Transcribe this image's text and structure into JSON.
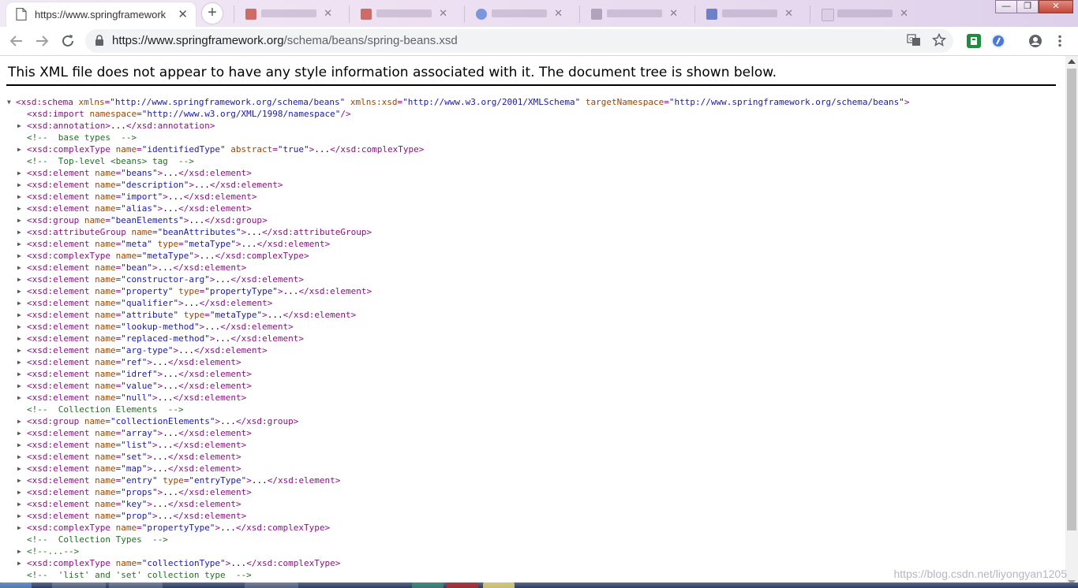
{
  "browser": {
    "active_tab": {
      "title": "https://www.springframework.org/schema/beans/spring-beans.xsd",
      "title_display": "https://www.springframework"
    },
    "new_tab_symbol": "+",
    "close_symbol": "✕",
    "window_controls": {
      "minimize": "—",
      "maximize": "❐",
      "close": "✕"
    },
    "url": {
      "host": "https://www.springframework.org",
      "path": "/schema/beans/spring-beans.xsd"
    },
    "icons": [
      "back-icon",
      "forward-icon",
      "reload-icon",
      "lock-icon",
      "translate-icon",
      "bookmark-star-icon",
      "extension-icon",
      "profile-icon",
      "menu-icon"
    ],
    "colors": {
      "tag": "#881280",
      "attribute": "#994500",
      "value": "#1a1aa6",
      "comment": "#236e25"
    }
  },
  "page": {
    "header_message": "This XML file does not appear to have any style information associated with it. The document tree is shown below."
  },
  "tree": [
    {
      "text": "<xsd:schema xmlns=\"http://www.springframework.org/schema/beans\" xmlns:xsd=\"http://www.w3.org/2001/XMLSchema\" targetNamespace=\"http://www.springframework.org/schema/beans\">",
      "kind": "root",
      "expand": "▼"
    },
    {
      "text": "<xsd:import namespace=\"http://www.w3.org/XML/1998/namespace\"/>",
      "kind": "leaf"
    },
    {
      "text": "<xsd:annotation>...</xsd:annotation>",
      "kind": "collapsed"
    },
    {
      "text": "<!--  base types  -->",
      "kind": "comment"
    },
    {
      "text": "<xsd:complexType name=\"identifiedType\" abstract=\"true\">...</xsd:complexType>",
      "kind": "collapsed"
    },
    {
      "text": "<!--  Top-level <beans> tag  -->",
      "kind": "comment"
    },
    {
      "text": "<xsd:element name=\"beans\">...</xsd:element>",
      "kind": "collapsed"
    },
    {
      "text": "<xsd:element name=\"description\">...</xsd:element>",
      "kind": "collapsed"
    },
    {
      "text": "<xsd:element name=\"import\">...</xsd:element>",
      "kind": "collapsed"
    },
    {
      "text": "<xsd:element name=\"alias\">...</xsd:element>",
      "kind": "collapsed"
    },
    {
      "text": "<xsd:group name=\"beanElements\">...</xsd:group>",
      "kind": "collapsed"
    },
    {
      "text": "<xsd:attributeGroup name=\"beanAttributes\">...</xsd:attributeGroup>",
      "kind": "collapsed"
    },
    {
      "text": "<xsd:element name=\"meta\" type=\"metaType\">...</xsd:element>",
      "kind": "collapsed"
    },
    {
      "text": "<xsd:complexType name=\"metaType\">...</xsd:complexType>",
      "kind": "collapsed"
    },
    {
      "text": "<xsd:element name=\"bean\">...</xsd:element>",
      "kind": "collapsed"
    },
    {
      "text": "<xsd:element name=\"constructor-arg\">...</xsd:element>",
      "kind": "collapsed"
    },
    {
      "text": "<xsd:element name=\"property\" type=\"propertyType\">...</xsd:element>",
      "kind": "collapsed"
    },
    {
      "text": "<xsd:element name=\"qualifier\">...</xsd:element>",
      "kind": "collapsed"
    },
    {
      "text": "<xsd:element name=\"attribute\" type=\"metaType\">...</xsd:element>",
      "kind": "collapsed"
    },
    {
      "text": "<xsd:element name=\"lookup-method\">...</xsd:element>",
      "kind": "collapsed"
    },
    {
      "text": "<xsd:element name=\"replaced-method\">...</xsd:element>",
      "kind": "collapsed"
    },
    {
      "text": "<xsd:element name=\"arg-type\">...</xsd:element>",
      "kind": "collapsed"
    },
    {
      "text": "<xsd:element name=\"ref\">...</xsd:element>",
      "kind": "collapsed"
    },
    {
      "text": "<xsd:element name=\"idref\">...</xsd:element>",
      "kind": "collapsed"
    },
    {
      "text": "<xsd:element name=\"value\">...</xsd:element>",
      "kind": "collapsed"
    },
    {
      "text": "<xsd:element name=\"null\">...</xsd:element>",
      "kind": "collapsed"
    },
    {
      "text": "<!--  Collection Elements  -->",
      "kind": "comment"
    },
    {
      "text": "<xsd:group name=\"collectionElements\">...</xsd:group>",
      "kind": "collapsed"
    },
    {
      "text": "<xsd:element name=\"array\">...</xsd:element>",
      "kind": "collapsed"
    },
    {
      "text": "<xsd:element name=\"list\">...</xsd:element>",
      "kind": "collapsed"
    },
    {
      "text": "<xsd:element name=\"set\">...</xsd:element>",
      "kind": "collapsed"
    },
    {
      "text": "<xsd:element name=\"map\">...</xsd:element>",
      "kind": "collapsed"
    },
    {
      "text": "<xsd:element name=\"entry\" type=\"entryType\">...</xsd:element>",
      "kind": "collapsed"
    },
    {
      "text": "<xsd:element name=\"props\">...</xsd:element>",
      "kind": "collapsed"
    },
    {
      "text": "<xsd:element name=\"key\">...</xsd:element>",
      "kind": "collapsed"
    },
    {
      "text": "<xsd:element name=\"prop\">...</xsd:element>",
      "kind": "collapsed"
    },
    {
      "text": "<xsd:complexType name=\"propertyType\">...</xsd:complexType>",
      "kind": "collapsed"
    },
    {
      "text": "<!--  Collection Types  -->",
      "kind": "comment"
    },
    {
      "text": "<!--...-->",
      "kind": "collapsed-comment"
    },
    {
      "text": "<xsd:complexType name=\"collectionType\">...</xsd:complexType>",
      "kind": "collapsed"
    },
    {
      "text": "<!--  'list' and 'set' collection type  -->",
      "kind": "comment"
    }
  ],
  "expand_symbol": "▶",
  "watermark": "https://blog.csdn.net/liyongyan1205"
}
